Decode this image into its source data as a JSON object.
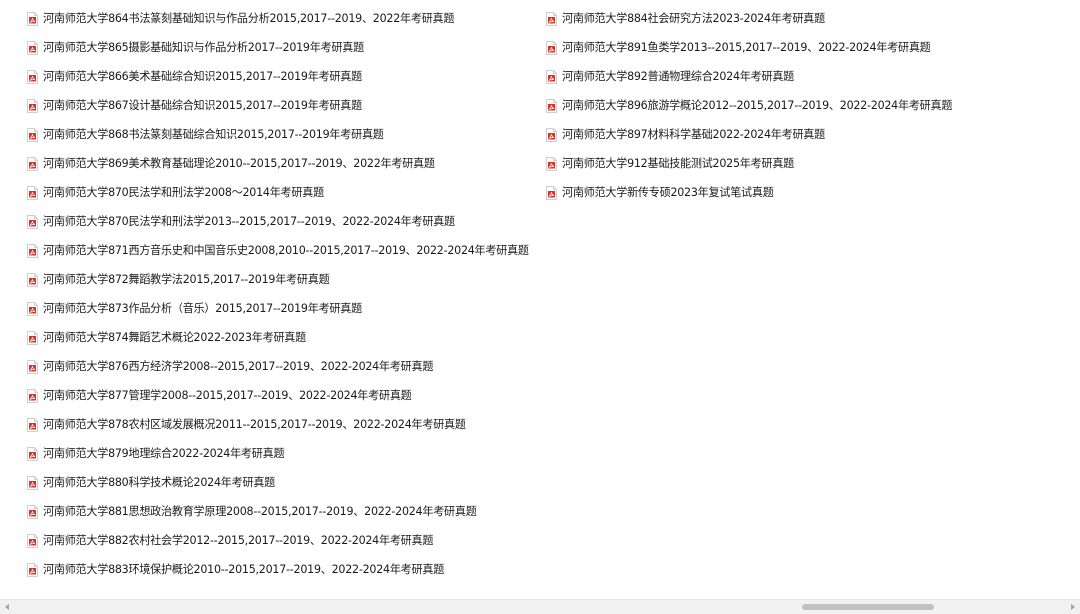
{
  "icon": "pdf-file-icon",
  "colors": {
    "icon_red": "#d9342b",
    "icon_border": "#cfcfcf",
    "text": "#1a1a1a",
    "scroll_track": "#f1f1f1",
    "scroll_thumb": "#c1c1c1"
  },
  "files": {
    "left": [
      "河南师范大学864书法篆刻基础知识与作品分析2015,2017--2019、2022年考研真题",
      "河南师范大学865摄影基础知识与作品分析2017--2019年考研真题",
      "河南师范大学866美术基础综合知识2015,2017--2019年考研真题",
      "河南师范大学867设计基础综合知识2015,2017--2019年考研真题",
      "河南师范大学868书法篆刻基础综合知识2015,2017--2019年考研真题",
      "河南师范大学869美术教育基础理论2010--2015,2017--2019、2022年考研真题",
      "河南师范大学870民法学和刑法学2008～2014年考研真题",
      "河南师范大学870民法学和刑法学2013--2015,2017--2019、2022-2024年考研真题",
      "河南师范大学871西方音乐史和中国音乐史2008,2010--2015,2017--2019、2022-2024年考研真题",
      "河南师范大学872舞蹈教学法2015,2017--2019年考研真题",
      "河南师范大学873作品分析（音乐）2015,2017--2019年考研真题",
      "河南师范大学874舞蹈艺术概论2022-2023年考研真题",
      "河南师范大学876西方经济学2008--2015,2017--2019、2022-2024年考研真题",
      "河南师范大学877管理学2008--2015,2017--2019、2022-2024年考研真题",
      "河南师范大学878农村区域发展概况2011--2015,2017--2019、2022-2024年考研真题",
      "河南师范大学879地理综合2022-2024年考研真题",
      "河南师范大学880科学技术概论2024年考研真题",
      "河南师范大学881思想政治教育学原理2008--2015,2017--2019、2022-2024年考研真题",
      "河南师范大学882农村社会学2012--2015,2017--2019、2022-2024年考研真题",
      "河南师范大学883环境保护概论2010--2015,2017--2019、2022-2024年考研真题"
    ],
    "right": [
      "河南师范大学884社会研究方法2023-2024年考研真题",
      "河南师范大学891鱼类学2013--2015,2017--2019、2022-2024年考研真题",
      "河南师范大学892普通物理综合2024年考研真题",
      "河南师范大学896旅游学概论2012--2015,2017--2019、2022-2024年考研真题",
      "河南师范大学897材料科学基础2022-2024年考研真题",
      "河南师范大学912基础技能测试2025年考研真题",
      "河南师范大学新传专硕2023年复试笔试真题"
    ]
  }
}
